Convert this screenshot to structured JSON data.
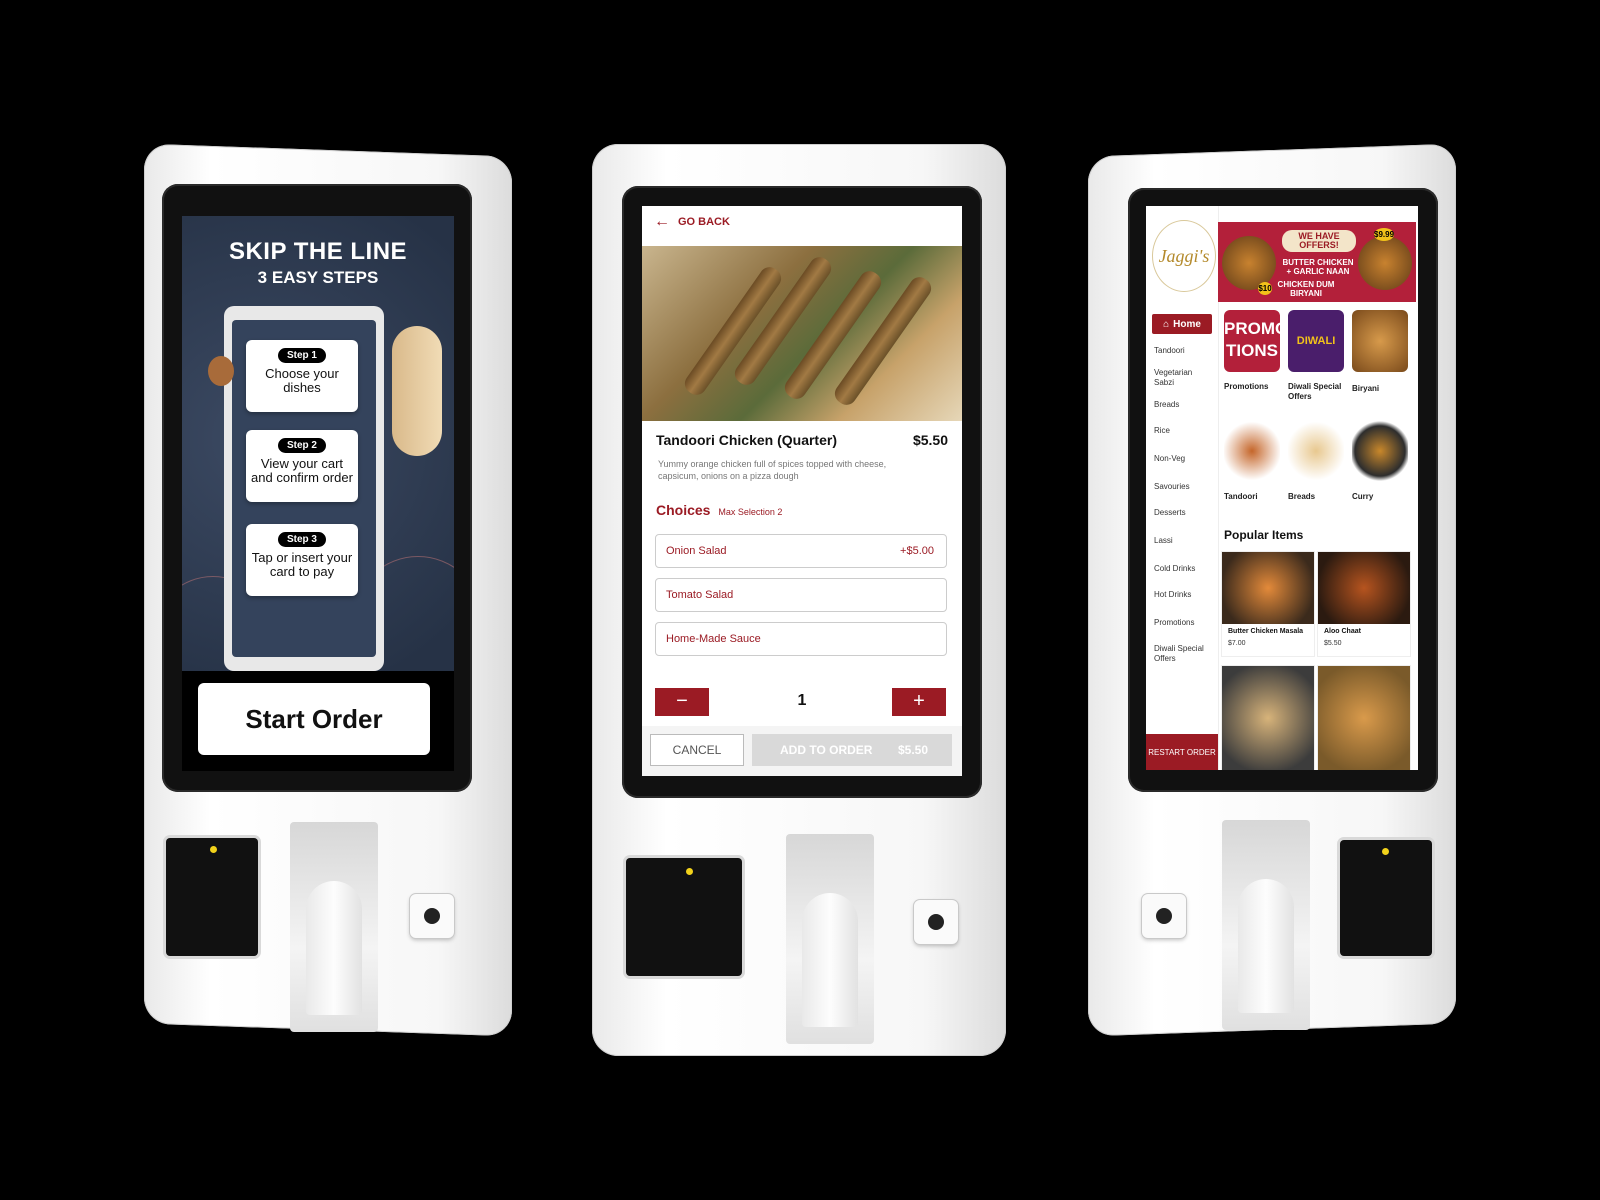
{
  "kiosk1": {
    "title": "SKIP THE LINE",
    "subtitle": "3 EASY STEPS",
    "steps": [
      {
        "pill": "Step 1",
        "text": "Choose your dishes"
      },
      {
        "pill": "Step 2",
        "text": "View your cart and confirm order"
      },
      {
        "pill": "Step 3",
        "text": "Tap or insert your card to pay"
      }
    ],
    "start_label": "Start Order"
  },
  "kiosk2": {
    "go_back": "GO BACK",
    "item": {
      "name": "Tandoori Chicken (Quarter)",
      "price": "$5.50",
      "description": "Yummy orange chicken full of spices topped with cheese, capsicum, onions on a pizza dough"
    },
    "choices_label": "Choices",
    "choices_max": "Max Selection 2",
    "choices": [
      {
        "label": "Onion Salad",
        "price": "+$5.00"
      },
      {
        "label": "Tomato Salad",
        "price": ""
      },
      {
        "label": "Home-Made Sauce",
        "price": ""
      }
    ],
    "quantity": "1",
    "minus": "−",
    "plus": "+",
    "cancel_label": "CANCEL",
    "add_label": "ADD TO ORDER",
    "add_price": "$5.50"
  },
  "kiosk3": {
    "logo": "Jaggi's",
    "banner": {
      "offer_text": "WE HAVE OFFERS!",
      "item1": "BUTTER CHICKEN + GARLIC NAAN",
      "item2": "CHICKEN DUM BIRYANI",
      "price1": "$10",
      "price2": "$9.99"
    },
    "home_label": "Home",
    "menu": [
      "Tandoori",
      "Vegetarian Sabzi",
      "Breads",
      "Rice",
      "Non-Veg",
      "Savouries",
      "Desserts",
      "Lassi",
      "Cold Drinks",
      "Hot Drinks",
      "Promotions",
      "Diwali Special Offers"
    ],
    "tiles": [
      {
        "label": "Promotions",
        "art": "PROMO TIONS"
      },
      {
        "label": "Diwali Special Offers",
        "art": "DIWALI"
      },
      {
        "label": "Biryani",
        "art": ""
      },
      {
        "label": "Tandoori",
        "art": ""
      },
      {
        "label": "Breads",
        "art": ""
      },
      {
        "label": "Curry",
        "art": ""
      }
    ],
    "popular_title": "Popular Items",
    "popular": [
      {
        "name": "Butter Chicken Masala",
        "price": "$7.00"
      },
      {
        "name": "Aloo Chaat",
        "price": "$5.50"
      },
      {
        "name": "",
        "price": ""
      },
      {
        "name": "",
        "price": ""
      }
    ],
    "restart_label": "RESTART ORDER"
  },
  "colors": {
    "brand_red": "#9b1b24",
    "led_yellow": "#f2d21b"
  }
}
